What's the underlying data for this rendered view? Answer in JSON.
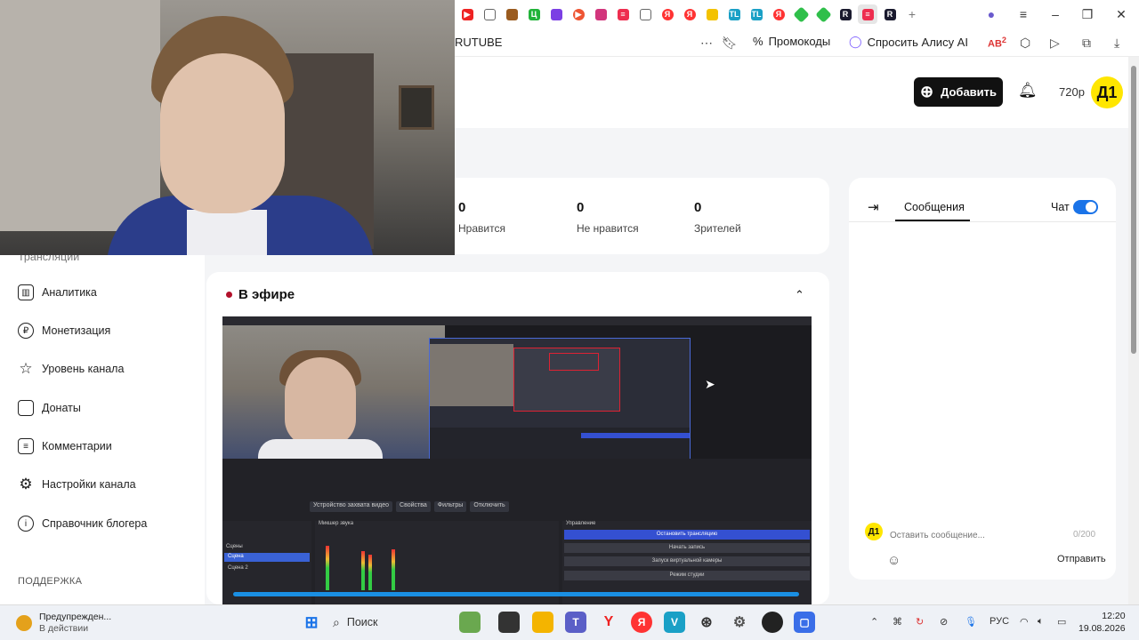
{
  "browser": {
    "tab_favicons": [
      "youtube-red",
      "doc",
      "box",
      "green-h",
      "purple-bars",
      "red-play",
      "gift",
      "rutube",
      "doc",
      "yandex",
      "yandex",
      "yellow-bag",
      "tl",
      "tl",
      "yandex",
      "green-leaf",
      "green-leaf",
      "rutube",
      "rutube-active",
      "rutube"
    ],
    "page_title": "RUTUBE",
    "promo_label": "Промокоды",
    "alice_label": "Спросить Алису AI",
    "ext_badge": "2"
  },
  "header": {
    "add_label": "Добавить",
    "quality": "720p",
    "avatar_text": "Д1"
  },
  "sidebar": {
    "partial_item": "Трансляции",
    "items": [
      {
        "label": "Аналитика",
        "icon": "chart-icon"
      },
      {
        "label": "Монетизация",
        "icon": "ruble-icon"
      },
      {
        "label": "Уровень канала",
        "icon": "star-icon"
      },
      {
        "label": "Донаты",
        "icon": "wallet-icon"
      },
      {
        "label": "Комментарии",
        "icon": "comment-icon"
      },
      {
        "label": "Настройки канала",
        "icon": "gear-icon"
      },
      {
        "label": "Справочник блогера",
        "icon": "info-icon"
      }
    ],
    "support_label": "ПОДДЕРЖКА"
  },
  "stats": [
    {
      "value": "0",
      "label": "Нравится"
    },
    {
      "value": "0",
      "label": "Не нравится"
    },
    {
      "value": "0",
      "label": "Зрителей"
    }
  ],
  "live": {
    "title": "В эфире",
    "obs_buttons": [
      "Устройство захвата видео",
      "Свойства",
      "Фильтры",
      "Отключить"
    ],
    "obs_mixer_title": "Микшер звука",
    "obs_controls_title": "Управление",
    "obs_controls": [
      "Остановить трансляцию",
      "Начать запись",
      "Запуск виртуальной камеры",
      "Режим студии"
    ],
    "obs_scenes": [
      "Сцены",
      "Сцена",
      "Сцена 2"
    ]
  },
  "chat": {
    "tab_label": "Сообщения",
    "toggle_label": "Чат",
    "avatar_text": "Д1",
    "input_placeholder": "Оставить сообщение...",
    "char_count": "0/200",
    "send_label": "Отправить"
  },
  "taskbar": {
    "notify_title": "Предупрежден...",
    "notify_sub": "В действии",
    "search_label": "Поиск",
    "lang": "РУС",
    "time": "12:20",
    "date": "19.08.2026"
  },
  "colors": {
    "accent": "#1a73e8",
    "live_dot": "#b2112b",
    "avatar": "#ffe600"
  }
}
